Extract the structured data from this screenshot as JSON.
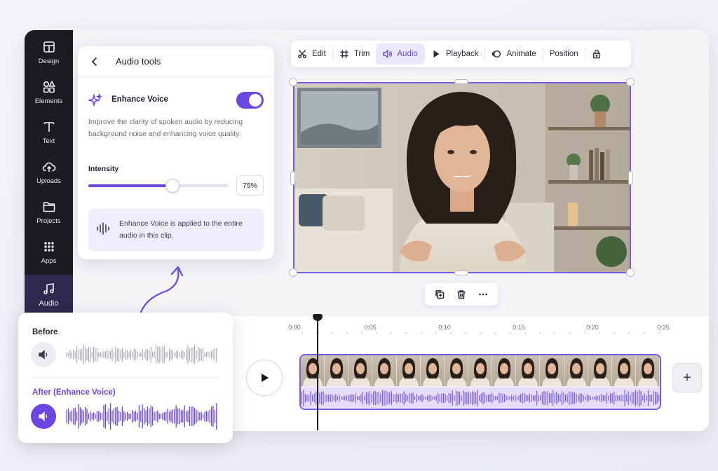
{
  "sidebar": {
    "items": [
      {
        "label": "Design",
        "icon": "layout-icon"
      },
      {
        "label": "Elements",
        "icon": "shapes-icon"
      },
      {
        "label": "Text",
        "icon": "text-icon"
      },
      {
        "label": "Uploads",
        "icon": "cloud-upload-icon"
      },
      {
        "label": "Projects",
        "icon": "folder-icon"
      },
      {
        "label": "Apps",
        "icon": "grid-icon"
      },
      {
        "label": "Audio",
        "icon": "music-note-icon",
        "active": true
      }
    ]
  },
  "toolbar": {
    "edit": "Edit",
    "trim": "Trim",
    "audio": "Audio",
    "playback": "Playback",
    "animate": "Animate",
    "position": "Position",
    "active": "Audio"
  },
  "audio_panel": {
    "title": "Audio tools",
    "feature_label": "Enhance Voice",
    "feature_enabled": true,
    "description": "Improve the clarity of spoken audio by reducing background noise and enhancing voice quality.",
    "intensity_label": "Intensity",
    "intensity_value": "75%",
    "intensity_fraction": 0.75,
    "info_text": "Enhance Voice is applied to the entire audio in this clip."
  },
  "timeline": {
    "ticks": [
      "0:00",
      "0:05",
      "0:10",
      "0:15",
      "0:20",
      "0:25"
    ],
    "add_label": "+"
  },
  "compare": {
    "before_label": "Before",
    "after_label": "After (Enhance Voice)"
  },
  "colors": {
    "accent": "#6b46e0",
    "rail_bg": "#1b1c20",
    "selection": "#7b5ae0"
  }
}
